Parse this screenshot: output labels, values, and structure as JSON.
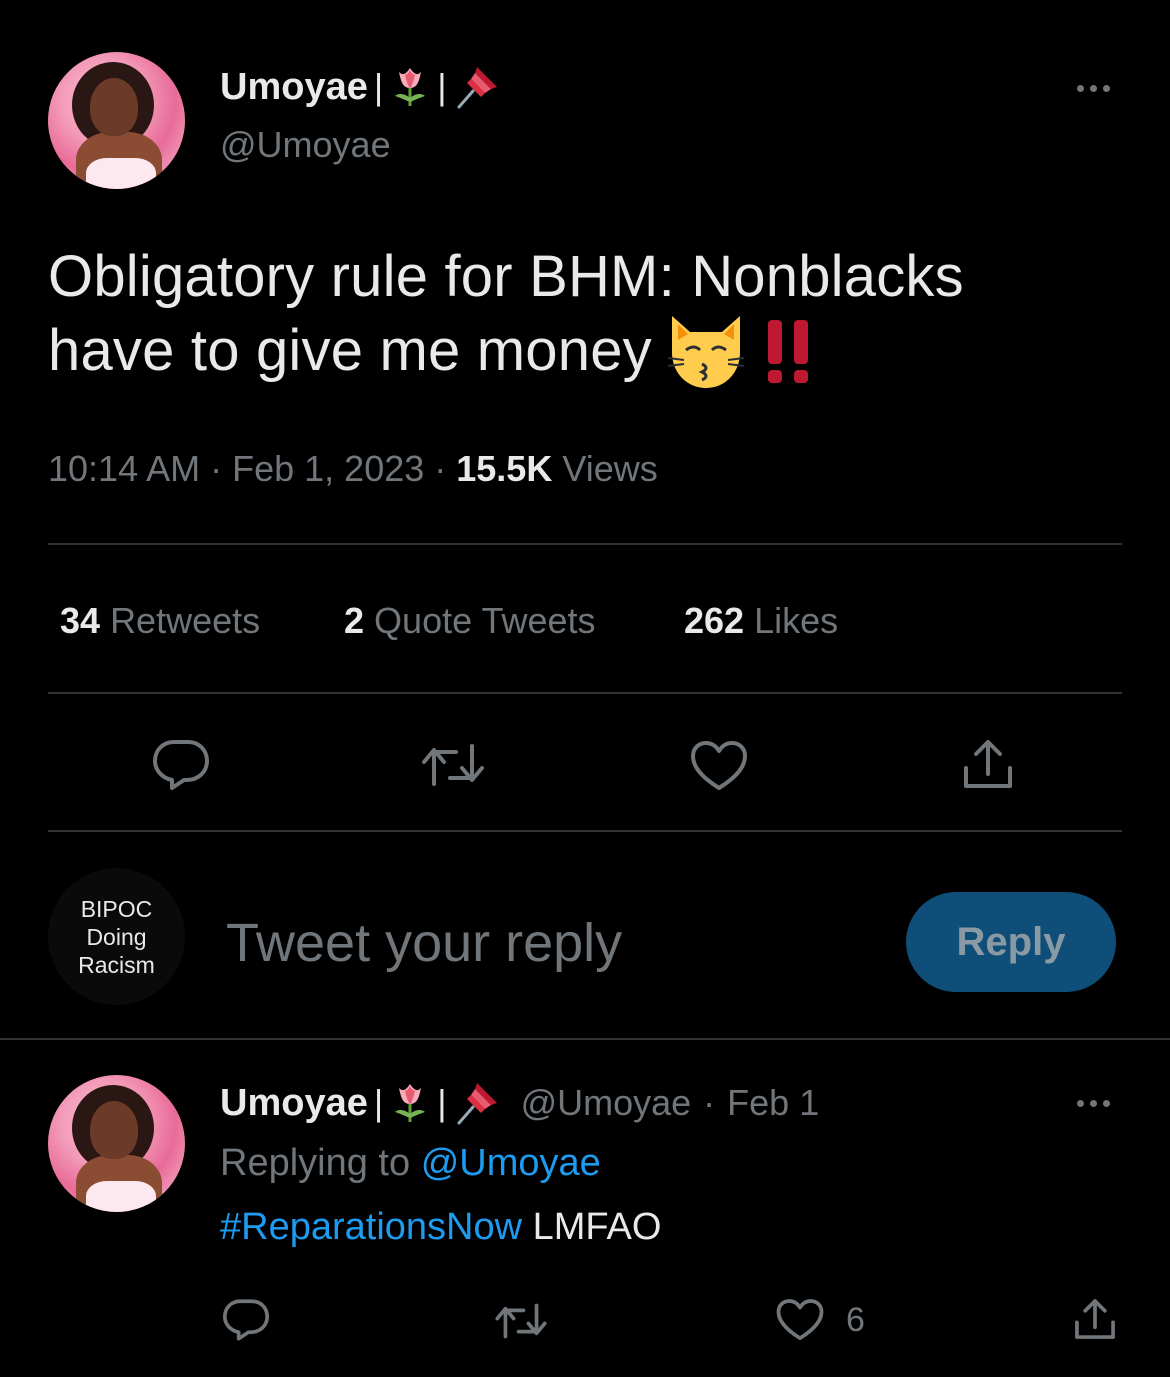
{
  "main_tweet": {
    "display_name": "Umoyae",
    "name_separators": [
      "|",
      "|"
    ],
    "handle": "@Umoyae",
    "text_line1": "Obligatory rule for BHM: Nonblacks",
    "text_line2": "have to give me money",
    "time": "10:14 AM",
    "dot": "·",
    "date": "Feb 1, 2023",
    "views_count": "15.5K",
    "views_label": "Views"
  },
  "stats": {
    "retweets_count": "34",
    "retweets_label": "Retweets",
    "quotes_count": "2",
    "quotes_label": "Quote Tweets",
    "likes_count": "262",
    "likes_label": "Likes"
  },
  "reply_composer": {
    "avatar_text": [
      "BIPOC",
      "Doing",
      "Racism"
    ],
    "placeholder": "Tweet your reply",
    "button_label": "Reply"
  },
  "reply_tweet": {
    "display_name": "Umoyae",
    "handle": "@Umoyae",
    "dot": "·",
    "date": "Feb 1",
    "replying_to_label": "Replying to",
    "replying_to_handle": "@Umoyae",
    "hashtag": "#ReparationsNow",
    "text": "LMFAO",
    "like_count": "6"
  },
  "colors": {
    "background": "#000000",
    "text_primary": "#e7e9ea",
    "text_secondary": "#71767b",
    "link": "#1d9bf0",
    "divider": "#2f3336",
    "reply_button": "#0f4e78"
  },
  "icons": [
    "tulip-emoji-icon",
    "pushpin-emoji-icon",
    "kissing-cat-emoji-icon",
    "double-exclamation-icon",
    "more-icon",
    "reply-icon",
    "retweet-icon",
    "like-icon",
    "share-icon"
  ]
}
